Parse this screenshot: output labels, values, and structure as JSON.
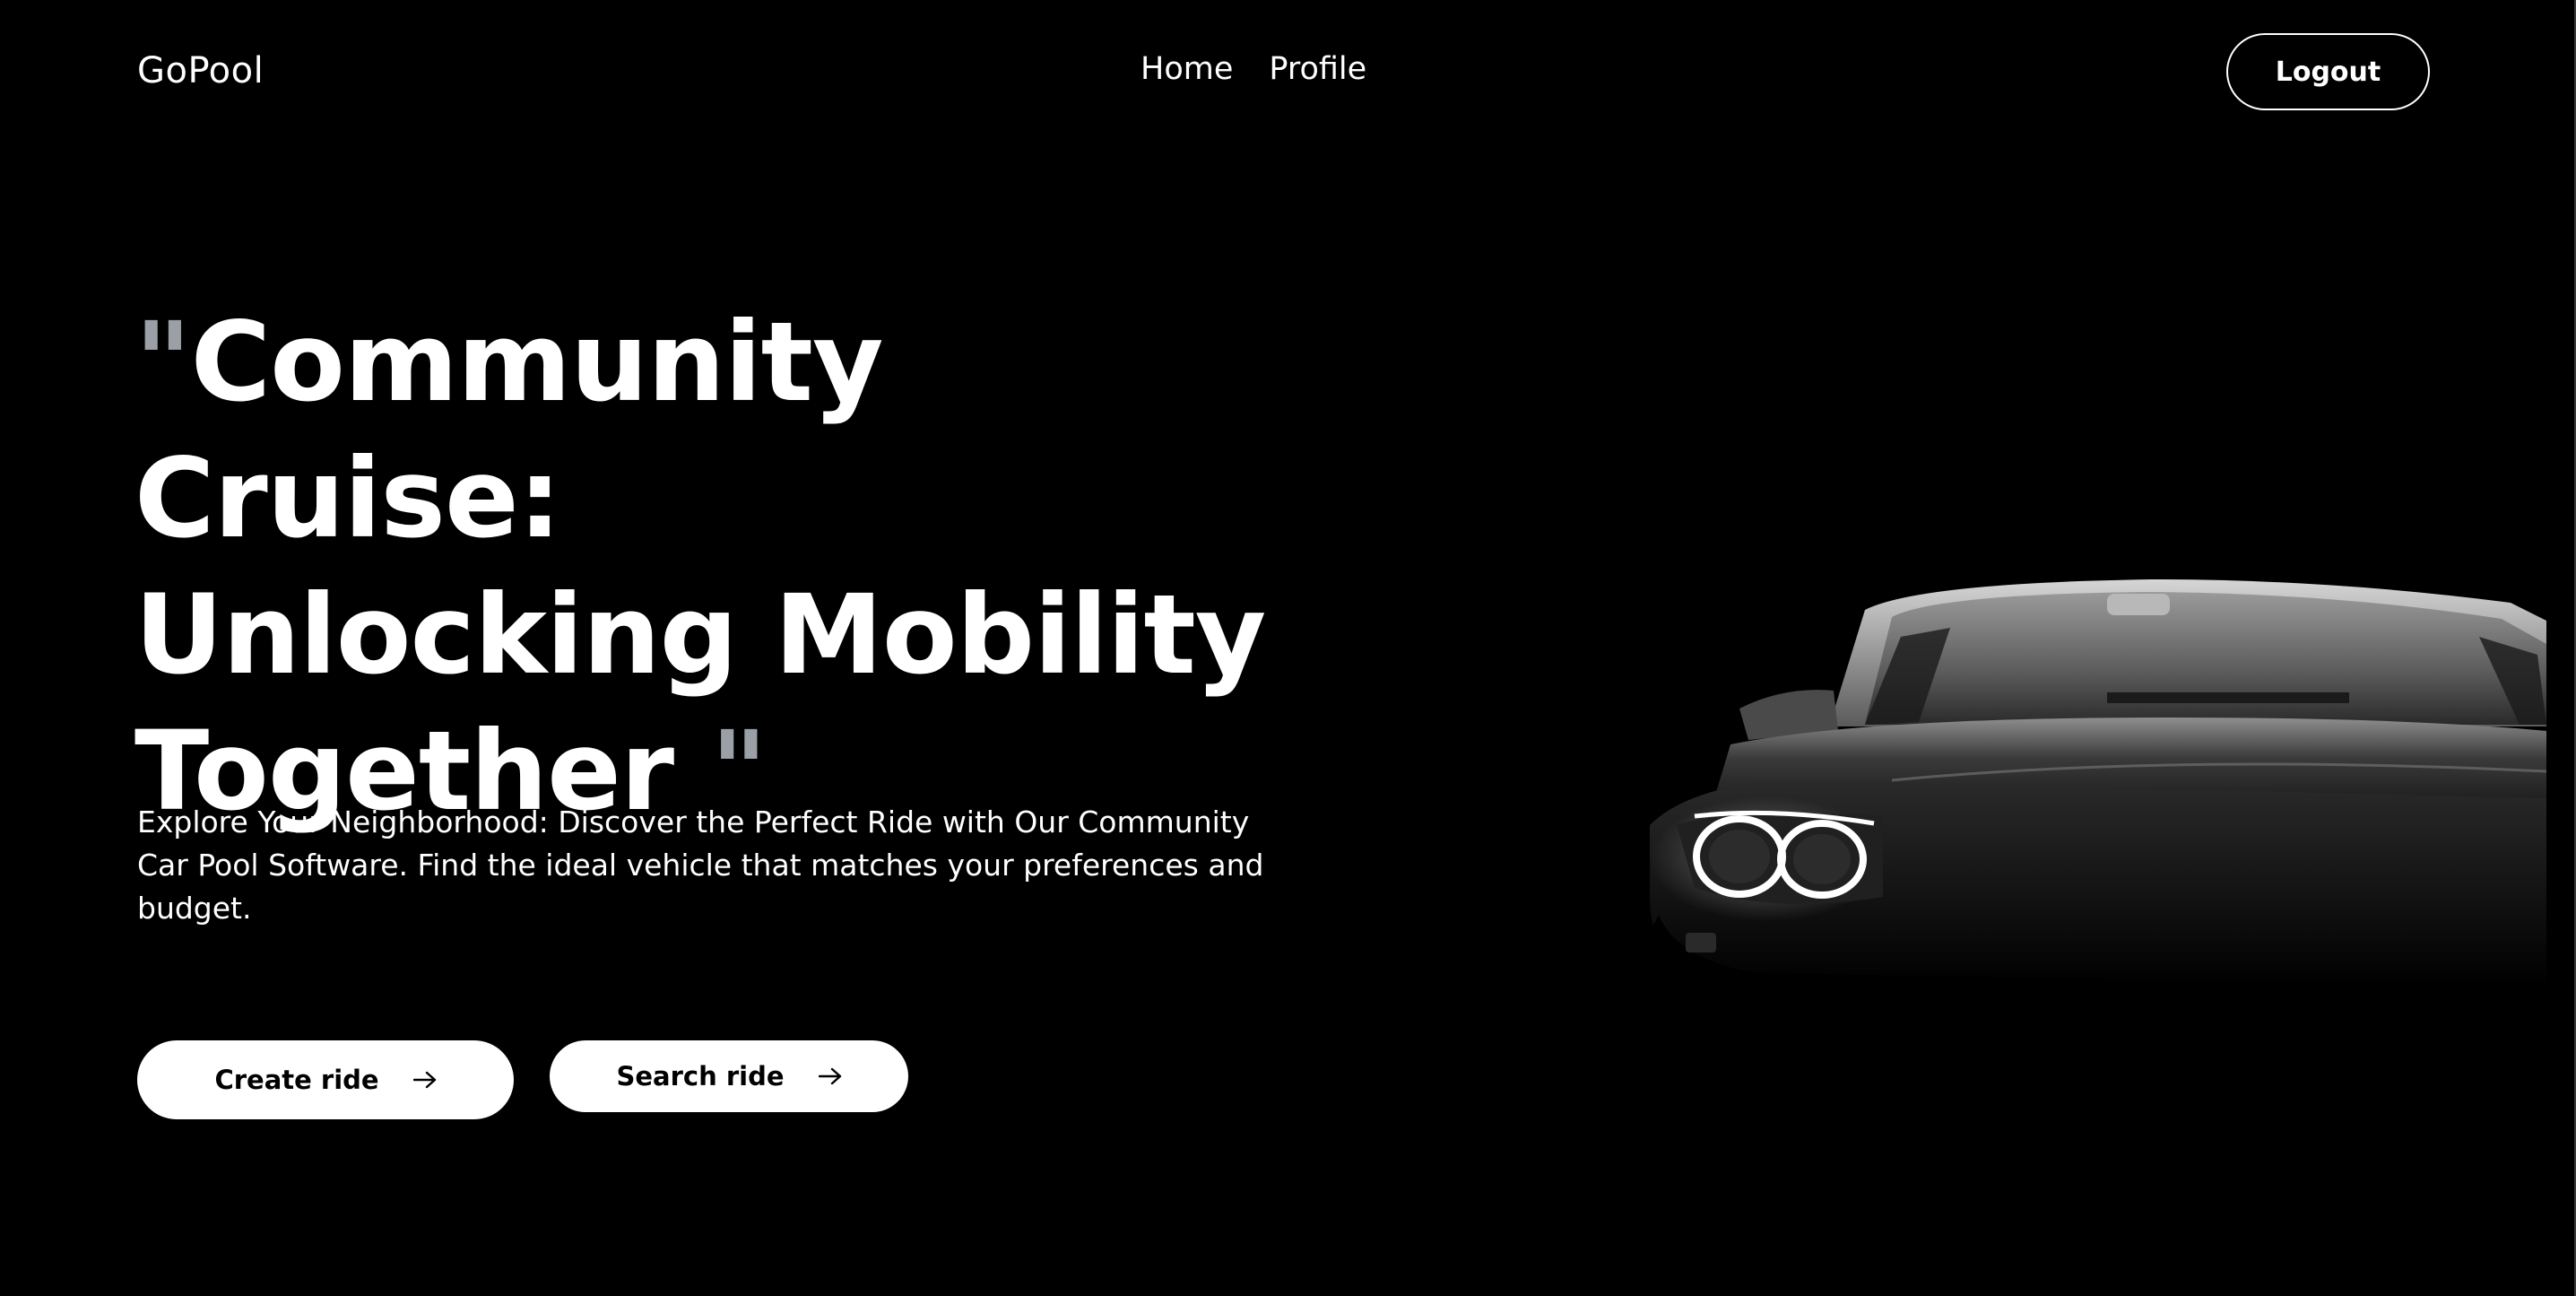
{
  "header": {
    "logo": "GoPool",
    "nav": [
      {
        "label": "Home"
      },
      {
        "label": "Profile"
      }
    ],
    "logout_label": "Logout"
  },
  "hero": {
    "open_quote": "\"",
    "title_line1": "Community Cruise:",
    "title_line2": "Unlocking Mobility",
    "title_line3": "Together ",
    "close_quote": "\"",
    "description": "Explore Your Neighborhood: Discover the Perfect Ride with Our Community Car Pool Software. Find the ideal vehicle that matches your preferences and budget.",
    "create_ride_label": "Create ride",
    "search_ride_label": "Search ride"
  },
  "colors": {
    "background": "#000000",
    "text": "#ffffff",
    "quote_accent": "#9aa0a6",
    "button_bg": "#ffffff"
  },
  "icons": {
    "button_arrow": "arrow-right-icon",
    "hero_image": "car-image"
  }
}
